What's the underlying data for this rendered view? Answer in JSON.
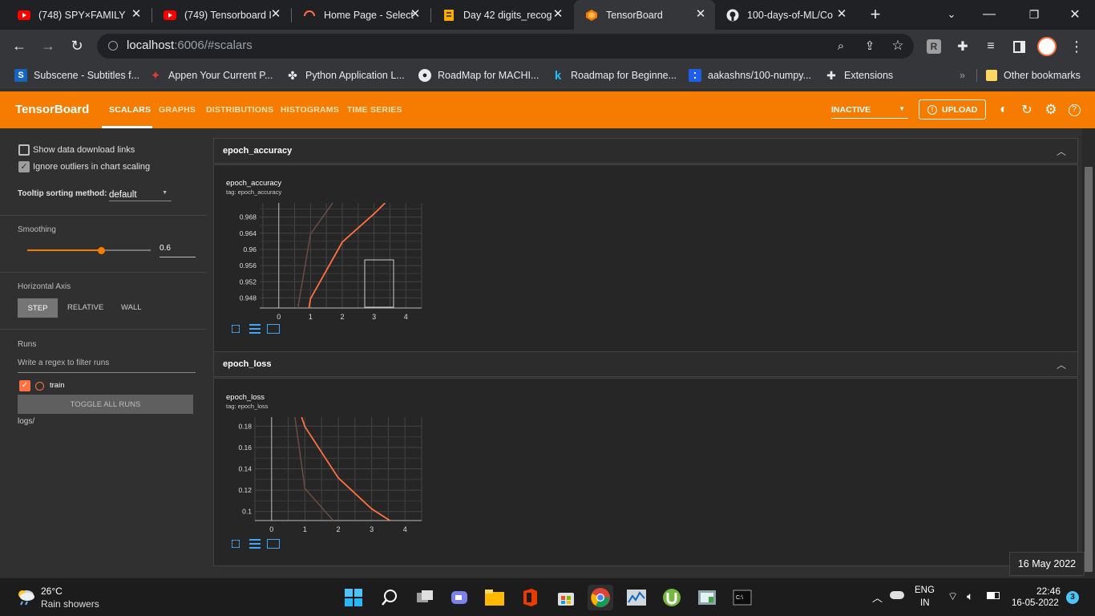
{
  "browser": {
    "tabs": [
      {
        "title": "(748) SPY×FAMILY",
        "favicon": "youtube-icon"
      },
      {
        "title": "(749) Tensorboard I",
        "favicon": "youtube-icon"
      },
      {
        "title": "Home Page - Select",
        "favicon": "loading-icon"
      },
      {
        "title": "Day 42 digits_recog",
        "favicon": "notebook-icon"
      },
      {
        "title": "TensorBoard",
        "favicon": "tensorboard-icon",
        "active": true
      },
      {
        "title": "100-days-of-ML/Co",
        "favicon": "github-icon"
      }
    ],
    "url_host": "localhost",
    "url_rest": ":6006/#scalars",
    "bookmarks": [
      {
        "label": "Subscene - Subtitles f...",
        "icon": "S"
      },
      {
        "label": "Appen Your Current P...",
        "icon": "appen"
      },
      {
        "label": "Python Application L...",
        "icon": "python"
      },
      {
        "label": "RoadMap for MACHI...",
        "icon": "github"
      },
      {
        "label": "Roadmap for Beginne...",
        "icon": "k"
      },
      {
        "label": "aakashns/100-numpy...",
        "icon": "jovian"
      },
      {
        "label": "Extensions",
        "icon": "puzzle"
      }
    ],
    "other_bookmarks": "Other bookmarks"
  },
  "tensorboard": {
    "title": "TensorBoard",
    "nav": [
      "SCALARS",
      "GRAPHS",
      "DISTRIBUTIONS",
      "HISTOGRAMS",
      "TIME SERIES"
    ],
    "status": "INACTIVE",
    "upload_label": "UPLOAD"
  },
  "sidebar": {
    "show_download": "Show data download links",
    "ignore_outliers": "Ignore outliers in chart scaling",
    "tooltip_label": "Tooltip sorting method:",
    "tooltip_value": "default",
    "smoothing_label": "Smoothing",
    "smoothing_value": "0.6",
    "smoothing_fraction": 0.6,
    "haxis_label": "Horizontal Axis",
    "haxis_options": [
      "STEP",
      "RELATIVE",
      "WALL"
    ],
    "runs_label": "Runs",
    "runs_filter_placeholder": "Write a regex to filter runs",
    "run_name": "train",
    "toggle_all": "TOGGLE ALL RUNS",
    "logdir": "logs/"
  },
  "cards": [
    {
      "header": "epoch_accuracy",
      "title": "epoch_accuracy",
      "tag": "tag: epoch_accuracy"
    },
    {
      "header": "epoch_loss",
      "title": "epoch_loss",
      "tag": "tag: epoch_loss"
    }
  ],
  "chart_data": [
    {
      "type": "line",
      "title": "epoch_accuracy",
      "subtitle": "tag: epoch_accuracy",
      "x_ticks": [
        "0",
        "1",
        "2",
        "3",
        "4"
      ],
      "y_ticks": [
        "0.948",
        "0.952",
        "0.956",
        "0.96",
        "0.964",
        "0.968"
      ],
      "xlim": [
        -0.6,
        4.5
      ],
      "ylim": [
        0.9455,
        0.9715
      ],
      "series": [
        {
          "role": "smoothed",
          "x": [
            0.95,
            1,
            2,
            3,
            3.35
          ],
          "y": [
            0.9455,
            0.9478,
            0.9618,
            0.9688,
            0.9715
          ]
        },
        {
          "role": "raw",
          "x": [
            0.6,
            1,
            1.7
          ],
          "y": [
            0.9455,
            0.9638,
            0.9715
          ]
        }
      ],
      "color_smoothed": "#ff7043",
      "color_raw": "#6d4c41",
      "grid": true
    },
    {
      "type": "line",
      "title": "epoch_loss",
      "subtitle": "tag: epoch_loss",
      "x_ticks": [
        "0",
        "1",
        "2",
        "3",
        "4"
      ],
      "y_ticks": [
        "0.1",
        "0.12",
        "0.14",
        "0.16",
        "0.18"
      ],
      "xlim": [
        -0.5,
        4.5
      ],
      "ylim": [
        0.0915,
        0.1885
      ],
      "series": [
        {
          "role": "smoothed",
          "x": [
            0.9,
            1,
            2,
            3,
            3.55
          ],
          "y": [
            0.1885,
            0.1795,
            0.1315,
            0.1025,
            0.0915
          ]
        },
        {
          "role": "raw",
          "x": [
            0.7,
            1,
            1.85
          ],
          "y": [
            0.1885,
            0.1215,
            0.0915
          ]
        }
      ],
      "color_smoothed": "#ff7043",
      "color_raw": "#6d4c41",
      "grid": true
    }
  ],
  "tooltip_date": "16 May 2022",
  "taskbar": {
    "weather_temp": "26°C",
    "weather_desc": "Rain showers",
    "lang_line1": "ENG",
    "lang_line2": "IN",
    "time": "22:46",
    "date": "16-05-2022",
    "notif_count": "3"
  },
  "colors": {
    "accent": "#f57c00",
    "run": "#ff7043"
  }
}
